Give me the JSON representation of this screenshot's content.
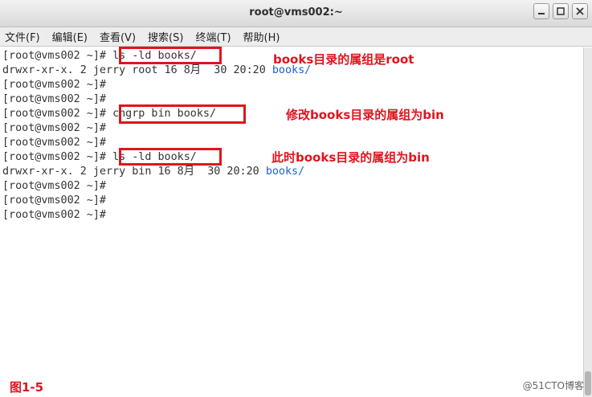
{
  "window": {
    "title": "root@vms002:~"
  },
  "window_controls": {
    "minimize": "minimize",
    "maximize": "maximize",
    "close": "close"
  },
  "menu": [
    "文件(F)",
    "编辑(E)",
    "查看(V)",
    "搜索(S)",
    "终端(T)",
    "帮助(H)"
  ],
  "terminal_lines": [
    {
      "prompt": "[root@vms002 ~]# ",
      "cmd": "ls -ld books/"
    },
    {
      "prefix": "drwxr-xr-x. 2 jerry root 16 8月  30 20:20 ",
      "dir": "books/"
    },
    {
      "prompt": "[root@vms002 ~]# ",
      "cmd": ""
    },
    {
      "prompt": "[root@vms002 ~]# ",
      "cmd": ""
    },
    {
      "prompt": "[root@vms002 ~]# ",
      "cmd": "chgrp bin books/"
    },
    {
      "prompt": "[root@vms002 ~]# ",
      "cmd": ""
    },
    {
      "prompt": "[root@vms002 ~]# ",
      "cmd": ""
    },
    {
      "prompt": "[root@vms002 ~]# ",
      "cmd": "ls -ld books/"
    },
    {
      "prefix": "drwxr-xr-x. 2 jerry bin 16 8月  30 20:20 ",
      "dir": "books/"
    },
    {
      "prompt": "[root@vms002 ~]# ",
      "cmd": ""
    },
    {
      "prompt": "[root@vms002 ~]# ",
      "cmd": ""
    },
    {
      "prompt": "[root@vms002 ~]# ",
      "cmd": ""
    }
  ],
  "annotations": [
    "books目录的属组是root",
    "修改books目录的属组为bin",
    "此时books目录的属组为bin"
  ],
  "figure_label": "图1-5",
  "watermark": "@51CTO博客",
  "colors": {
    "highlight": "#e0141e",
    "directory": "#1e5fd1",
    "text": "#333333"
  }
}
